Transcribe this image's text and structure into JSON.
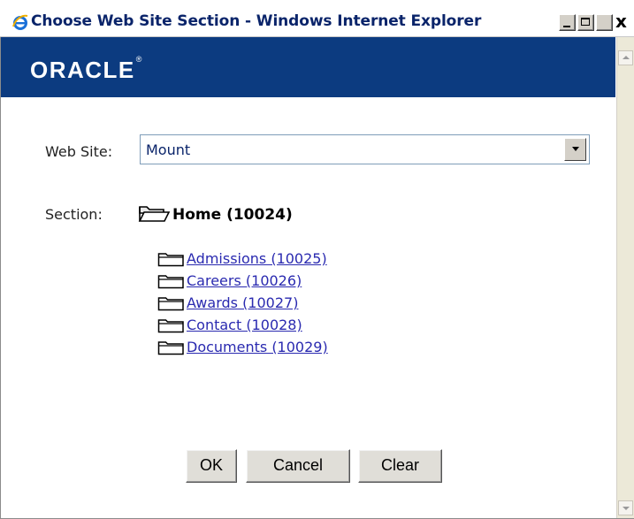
{
  "window": {
    "title": "Choose Web Site Section - Windows Internet Explorer",
    "close_glyph": "x",
    "icons": {
      "app": "internet-explorer-icon",
      "minimize": "minimize-icon",
      "maximize": "maximize-icon",
      "close": "close-icon"
    }
  },
  "header": {
    "logo_text": "ORACLE",
    "logo_mark": "®",
    "background": "#0c3b80"
  },
  "form": {
    "website_label": "Web Site:",
    "website_value": "Mount",
    "section_label": "Section:",
    "home": {
      "label": "Home (10024)",
      "icon": "open-folder-icon"
    }
  },
  "sections": [
    {
      "label": "Admissions (10025)",
      "icon": "folder-icon"
    },
    {
      "label": "Careers (10026)",
      "icon": "folder-icon"
    },
    {
      "label": "Awards (10027)",
      "icon": "folder-icon"
    },
    {
      "label": "Contact (10028)",
      "icon": "folder-icon"
    },
    {
      "label": "Documents (10029)",
      "icon": "folder-icon"
    }
  ],
  "buttons": {
    "ok": "OK",
    "cancel": "Cancel",
    "clear": "Clear"
  },
  "colors": {
    "link": "#2a2ab0",
    "title_text": "#0a246a",
    "button_face": "#e0ded8"
  }
}
